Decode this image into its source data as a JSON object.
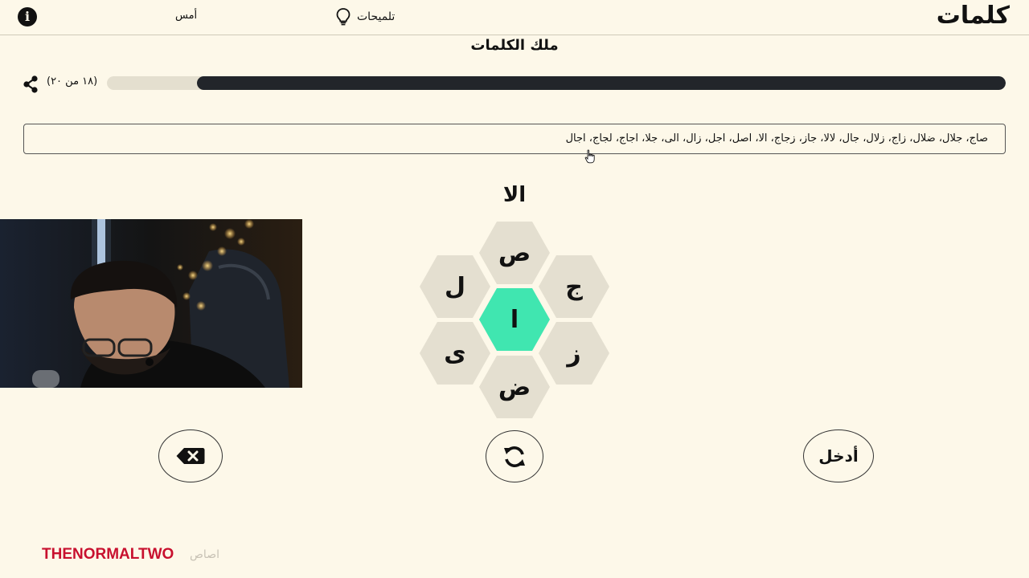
{
  "header": {
    "logo": "كلمات",
    "hints_label": "تلميحات",
    "yesterday_label": "أمس",
    "info_icon": "info-icon"
  },
  "rank_title": "ملك الكلمات",
  "progress": {
    "count_text": "(١٨ من ٢٠)",
    "fraction": 0.9
  },
  "found_words": "صاج، جلال، ضلال، زاج، زلال، جال، لالا، جاز، زجاج، الا، اصل، اجل، زال، الى، جلا، اجاج، لجاج، اجال",
  "current_word": "الا",
  "letters": {
    "center": "ا",
    "top": "ص",
    "top_right": "ج",
    "bottom_right": "ز",
    "bottom": "ض",
    "bottom_left": "ى",
    "top_left": "ل"
  },
  "colors": {
    "background": "#fdf8e9",
    "hex_outer": "#e4dfd0",
    "hex_center": "#40e6b0",
    "progress_fill": "#22252a",
    "watermark": "#c8102e"
  },
  "controls": {
    "delete_icon": "backspace-icon",
    "shuffle_icon": "refresh-icon",
    "enter_label": "أدخل"
  },
  "watermark": {
    "brand": "THENORMALTWO",
    "arabic": "اصاص"
  }
}
